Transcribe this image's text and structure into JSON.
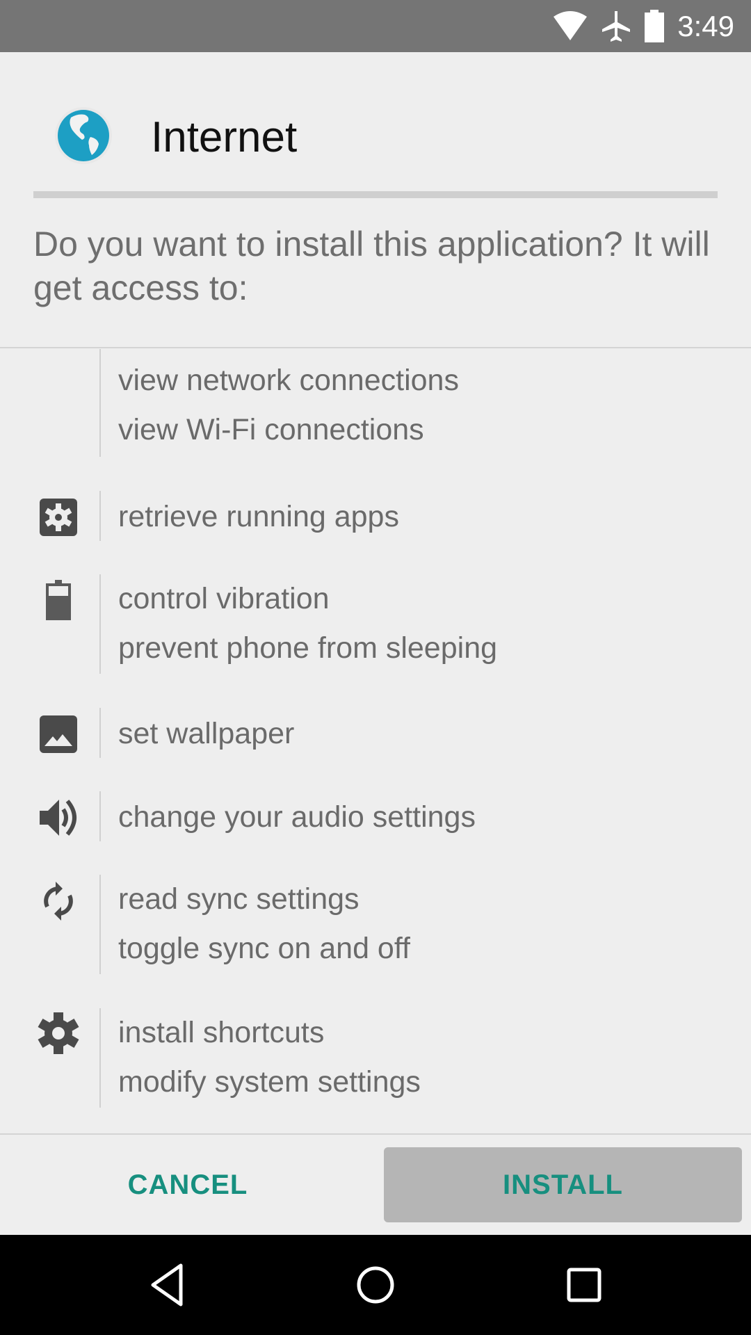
{
  "status_bar": {
    "time": "3:49",
    "icons": [
      "wifi-icon",
      "airplane-mode-icon",
      "battery-full-icon"
    ]
  },
  "header": {
    "app_name": "Internet",
    "app_icon": "globe-icon"
  },
  "prompt": "Do you want to install this application? It will get access to:",
  "permissions": [
    {
      "icon": "none",
      "lines": [
        "view network connections",
        "view Wi-Fi connections"
      ]
    },
    {
      "icon": "settings-box-icon",
      "lines": [
        "retrieve running apps"
      ]
    },
    {
      "icon": "battery-icon",
      "lines": [
        "control vibration",
        "prevent phone from sleeping"
      ]
    },
    {
      "icon": "image-icon",
      "lines": [
        "set wallpaper"
      ]
    },
    {
      "icon": "volume-icon",
      "lines": [
        "change your audio settings"
      ]
    },
    {
      "icon": "sync-icon",
      "lines": [
        "read sync settings",
        "toggle sync on and off"
      ]
    },
    {
      "icon": "gear-icon",
      "lines": [
        "install shortcuts",
        "modify system settings"
      ]
    }
  ],
  "buttons": {
    "cancel": "CANCEL",
    "install": "INSTALL"
  },
  "colors": {
    "accent": "#178f7f",
    "status_bar": "#757575",
    "background": "#eeeeee",
    "install_button_bg": "#b5b5b5"
  },
  "nav_bar": {
    "buttons": [
      "back-icon",
      "home-icon",
      "recents-icon"
    ]
  }
}
